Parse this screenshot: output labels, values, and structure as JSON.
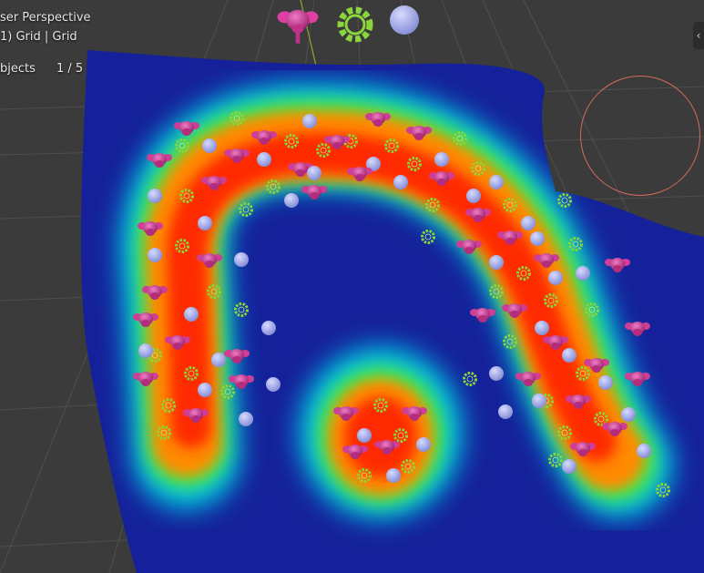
{
  "viewport": {
    "title": "ser Perspective",
    "collection_info": "1) Grid | Grid",
    "objects_label": "bjects",
    "objects_count": "1 / 5",
    "sidebar_toggle": "‹"
  },
  "header_icons": [
    "monkey-icon",
    "gear-icon",
    "sphere-icon"
  ],
  "heatmap_colors": {
    "background": "#14219a",
    "cyan": "#00c6e6",
    "green": "#4ee83a",
    "yellow": "#f7f100",
    "orange": "#ff8a00",
    "red": "#ff2a00"
  },
  "scatter_colors": {
    "monkey": "#cc3a92",
    "gear": "#7fd63a",
    "sphere": "#9ea6e8"
  },
  "grid_floor_color": "#4a4a4a"
}
